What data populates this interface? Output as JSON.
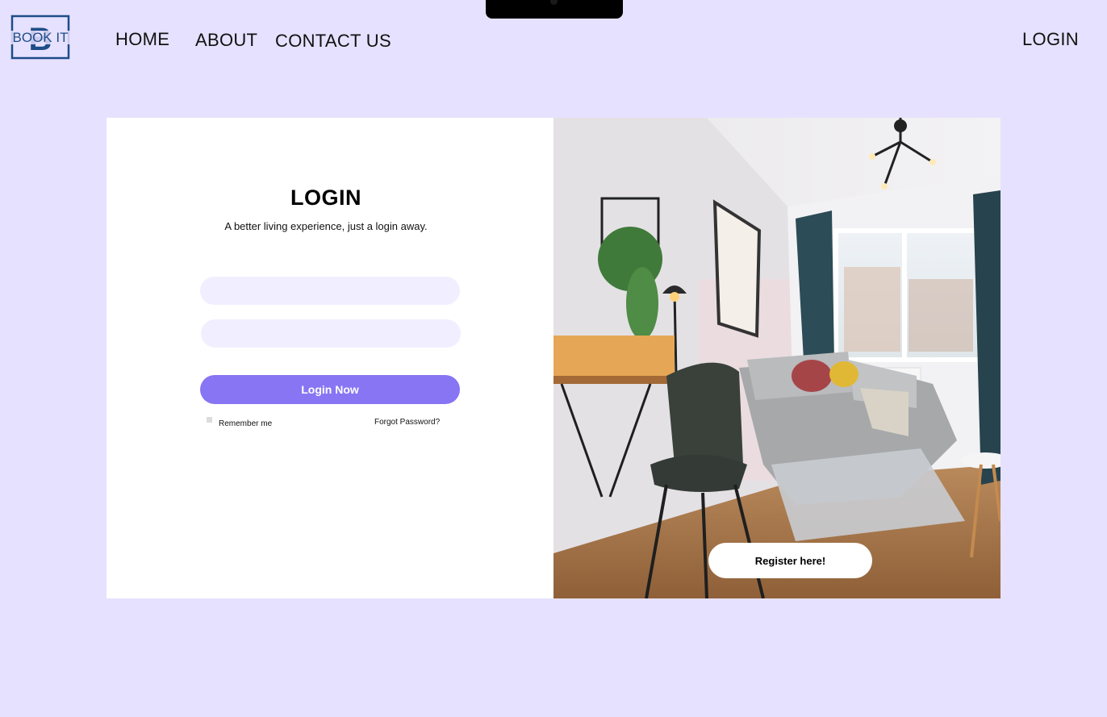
{
  "nav": {
    "logo_text": "BOOK IT",
    "logo_letter": "B",
    "home": "HOME",
    "about": "ABOUT",
    "contact": "CONTACT US",
    "login": "LOGIN"
  },
  "login_form": {
    "title": "LOGIN",
    "subtitle": "A better living experience, just a login away.",
    "username_value": "",
    "password_value": "",
    "submit_label": "Login Now",
    "remember_label": "Remember me",
    "remember_checked": false,
    "forgot_label": "Forgot Password?"
  },
  "hero": {
    "image_subject": "living-room-photo",
    "register_label": "Register here!"
  },
  "colors": {
    "page_background": "#e6e1fe",
    "accent": "#8775f3",
    "field_background": "#f1efff",
    "logo": "#1e4d88"
  }
}
